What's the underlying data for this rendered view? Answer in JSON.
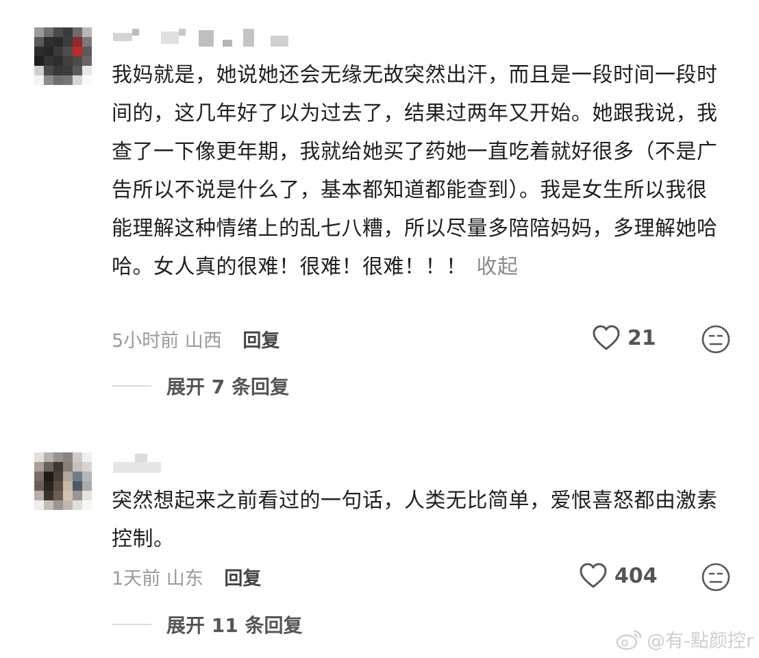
{
  "comments": [
    {
      "text": "我妈就是，她说她还会无缘无故突然出汗，而且是一段时间一段时间的，这几年好了以为过去了，结果过两年又开始。她跟我说，我查了一下像更年期，我就给她买了药她一直吃着就好很多（不是广告所以不说是什么了，基本都知道都能查到）。我是女生所以我很能理解这种情绪上的乱七八糟，所以尽量多陪陪妈妈，多理解她哈哈。女人真的很难！很难！很难！！！",
      "collapse_label": "收起",
      "time": "5小时前",
      "location": "山西",
      "reply_label": "回复",
      "likes": "21",
      "expand_label": "展开 7 条回复"
    },
    {
      "text": "突然想起来之前看过的一句话，人类无比简单，爱恨喜怒都由激素控制。",
      "time": "1天前",
      "location": "山东",
      "reply_label": "回复",
      "likes": "404",
      "expand_label": "展开 11 条回复"
    }
  ],
  "icons": {
    "like": "heart-outline-icon",
    "dislike": "meh-face-icon",
    "watermark": "weibo-logo-icon"
  },
  "watermark": "@有-點颜控r"
}
